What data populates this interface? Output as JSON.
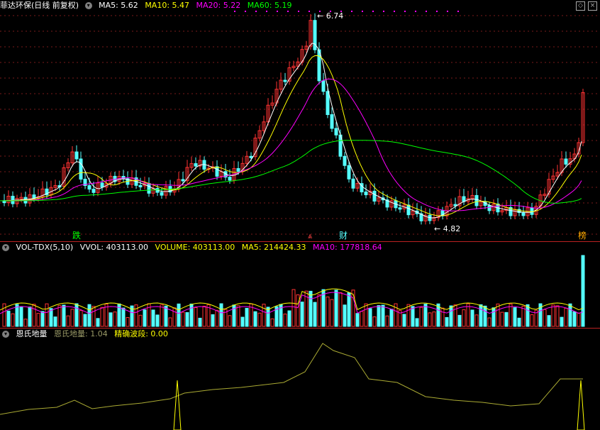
{
  "main": {
    "title": "菲达环保(日线 前复权)",
    "ma5": "MA5: 5.62",
    "ma10": "MA10: 5.47",
    "ma20": "MA20: 5.22",
    "ma60": "MA60: 5.19",
    "high_label": "6.74",
    "low_label": "4.82",
    "marker_die": "跌",
    "marker_cai": "财",
    "marker_bang": "榜",
    "colors": {
      "ma5": "#ffffff",
      "ma10": "#ffff00",
      "ma20": "#ff00ff",
      "ma60": "#00ff00",
      "up": "#ff3232",
      "down": "#54ffff"
    }
  },
  "volume": {
    "title": "VOL-TDX(5,10)",
    "vvol": "VVOL: 403113.00",
    "volume": "VOLUME: 403113.00",
    "ma5": "MA5: 214424.33",
    "ma10": "MA10: 177818.64"
  },
  "indicator": {
    "title": "恩氏地量",
    "value1": "恩氏地量: 1.04",
    "value2": "精确波段: 0.00"
  }
}
